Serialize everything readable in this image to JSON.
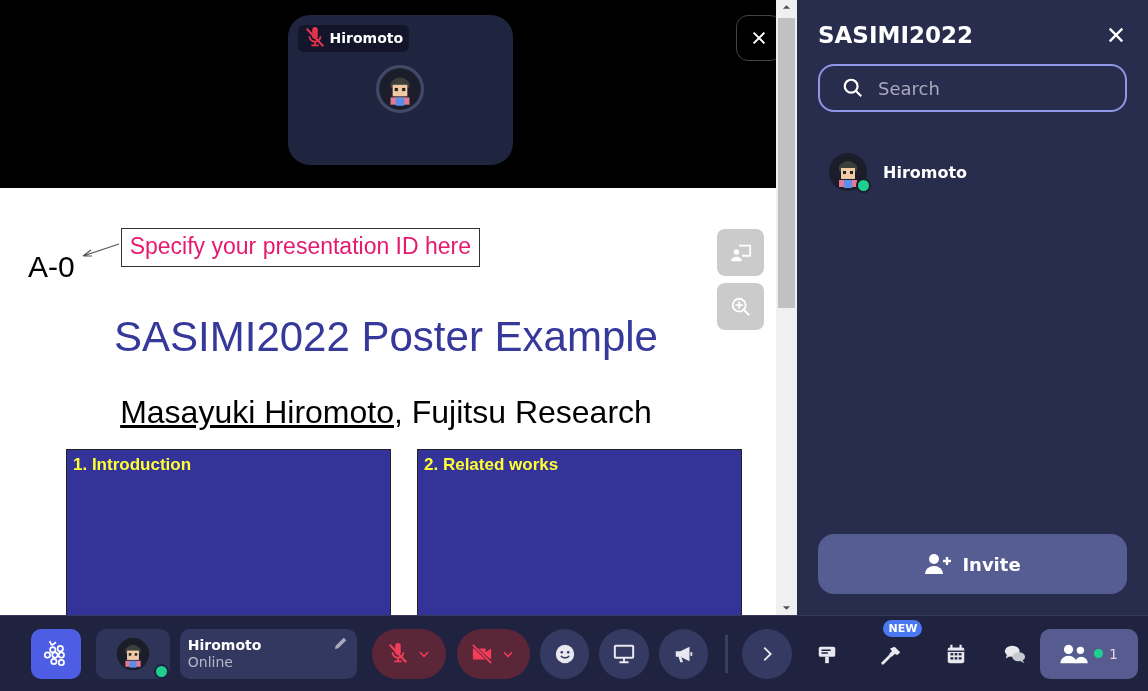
{
  "video_tile": {
    "name": "Hiromoto",
    "muted": true
  },
  "poster": {
    "presentation_id": "A-0",
    "callout": "Specify your presentation ID here",
    "title": "SASIMI2022 Poster Example",
    "author": "Masayuki Hiromoto",
    "affiliation": ", Fujitsu Research",
    "sections": [
      {
        "heading": "1. Introduction"
      },
      {
        "heading": "2. Related works"
      }
    ]
  },
  "sidebar": {
    "title": "SASIMI2022",
    "search": {
      "placeholder": "Search"
    },
    "members": [
      {
        "name": "Hiromoto",
        "online": true
      }
    ],
    "invite_button": "Invite"
  },
  "toolbar": {
    "user": {
      "name": "Hiromoto",
      "status": "Online",
      "online": true
    },
    "mic": {
      "on": false
    },
    "camera": {
      "on": false
    },
    "new_badge": "NEW",
    "participants_count": "1",
    "participants_online": true
  }
}
